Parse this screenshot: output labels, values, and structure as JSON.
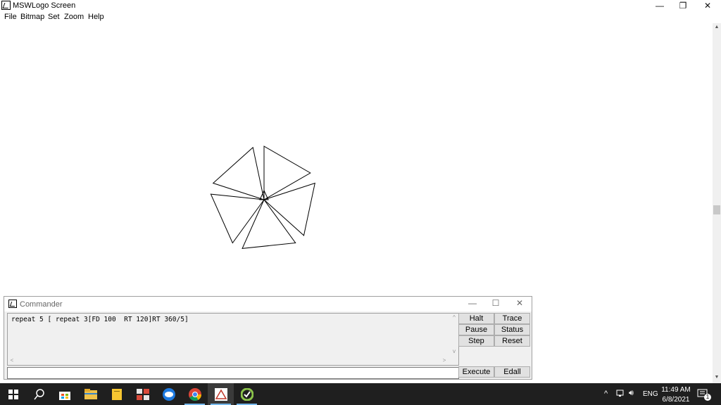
{
  "window": {
    "title": "MSWLogo Screen",
    "minimize": "—",
    "restore": "❐",
    "close": "✕"
  },
  "menu": [
    "File",
    "Bitmap",
    "Set",
    "Zoom",
    "Help"
  ],
  "commander": {
    "title": "Commander",
    "minimize": "—",
    "maximize": "☐",
    "close": "✕",
    "history": [
      "repeat 5 [ repeat 3[FD 100  RT 120]RT 360/5]"
    ],
    "input_value": "",
    "buttons": {
      "halt": "Halt",
      "trace": "Trace",
      "pause": "Pause",
      "status": "Status",
      "step": "Step",
      "reset": "Reset",
      "execute": "Execute",
      "edall": "Edall"
    }
  },
  "taskbar": {
    "apps": [
      "start-icon",
      "search-icon",
      "store-icon",
      "file-explorer-icon",
      "sticky-notes-icon",
      "app-icon",
      "zalo-icon",
      "chrome-icon",
      "mswlogo-icon",
      "app-green-icon"
    ],
    "language": "ENG",
    "time": "11:49 AM",
    "date": "6/8/2021",
    "notification_count": "1"
  }
}
